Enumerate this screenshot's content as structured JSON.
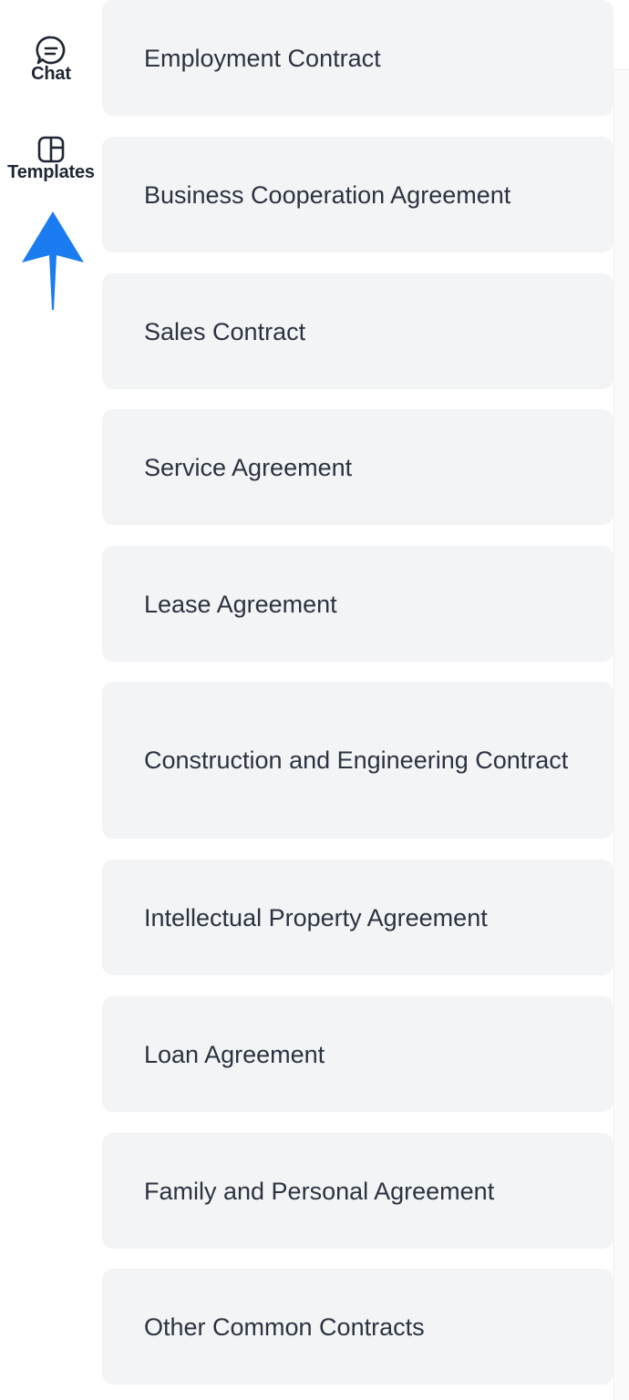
{
  "nav": {
    "chat": {
      "label": "Chat",
      "icon": "chat-bubble-icon"
    },
    "templates": {
      "label": "Templates",
      "icon": "template-layout-icon"
    },
    "pointer_icon": "arrow-up-icon"
  },
  "templates": [
    "Employment Contract",
    "Business Cooperation Agreement",
    "Sales Contract",
    "Service Agreement",
    "Lease Agreement",
    "Construction and Engineering Contract",
    "Intellectual Property Agreement",
    "Loan Agreement",
    "Family and Personal Agreement",
    "Other Common Contracts"
  ],
  "colors": {
    "card_bg": "#f3f4f6",
    "text": "#2b3340",
    "arrow": "#1a7cf0"
  }
}
